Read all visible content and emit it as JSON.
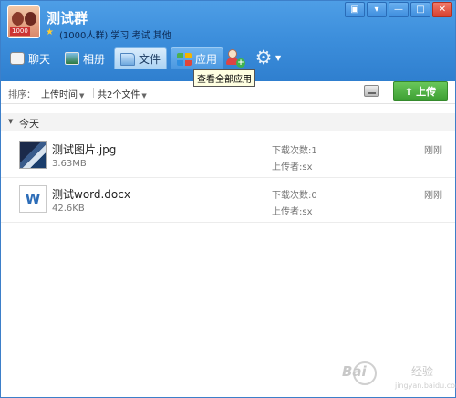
{
  "window": {
    "group_name": "测试群",
    "group_sub": "(1000人群) 学习 考试 其他",
    "avatar_tag": "1000",
    "window_buttons": [
      "▣",
      "▾",
      "—",
      "□",
      "✕"
    ]
  },
  "tabs": [
    {
      "label": "聊天",
      "icon": "chat-icon",
      "state": "normal"
    },
    {
      "label": "相册",
      "icon": "album-icon",
      "state": "normal"
    },
    {
      "label": "文件",
      "icon": "folder-icon",
      "state": "active"
    },
    {
      "label": "应用",
      "icon": "apps-icon",
      "state": "hover"
    }
  ],
  "tooltip": "查看全部应用",
  "toolbar": {
    "sort_label": "排序：",
    "sort_value": "上传时间",
    "count_value": "共2个文件",
    "upload_label": "上传"
  },
  "section": {
    "title": "今天"
  },
  "files": [
    {
      "name": "测试图片.jpg",
      "size": "3.63MB",
      "downloads": "下载次数:1",
      "uploader": "上传者:sx",
      "time": "刚刚",
      "type": "image"
    },
    {
      "name": "测试word.docx",
      "size": "42.6KB",
      "downloads": "下载次数:0",
      "uploader": "上传者:sx",
      "time": "刚刚",
      "type": "word"
    }
  ],
  "watermark": {
    "text": "Bai",
    "sub": "经验",
    "url": "jingyan.baidu.com"
  },
  "colors": {
    "titlebar": "#3d8fdc",
    "upload_button": "#4cae3f",
    "accent": "#2d6db8"
  }
}
